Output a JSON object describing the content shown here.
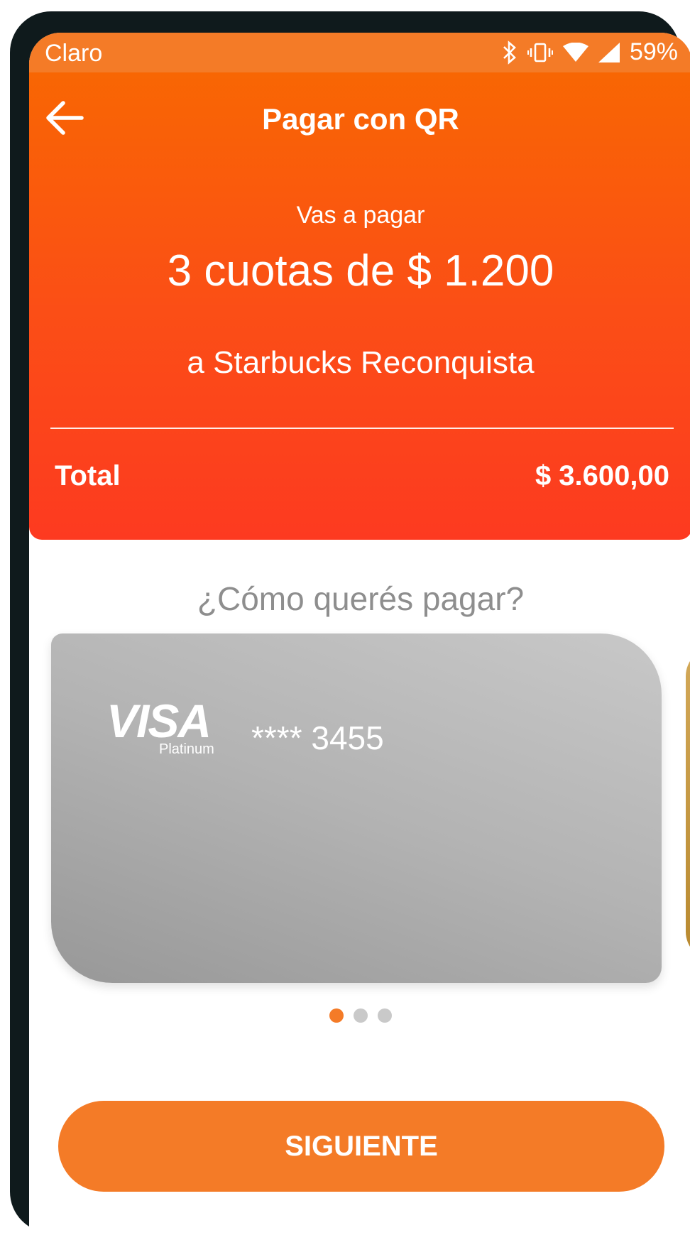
{
  "status_bar": {
    "carrier": "Claro",
    "battery": "59%",
    "icons": [
      "bluetooth-icon",
      "vibrate-icon",
      "wifi-icon",
      "signal-icon"
    ]
  },
  "header": {
    "back_icon": "arrow-left-icon",
    "title": "Pagar con QR",
    "lead": "Vas a pagar",
    "amount": "3 cuotas de $ 1.200",
    "merchant": "a Starbucks Reconquista",
    "total_label": "Total",
    "total_value": "$ 3.600,00"
  },
  "payment": {
    "question": "¿Cómo querés pagar?",
    "card": {
      "brand": "VISA",
      "tier": "Platinum",
      "number": "**** 3455"
    },
    "pages": {
      "count": 3,
      "active": 1
    }
  },
  "actions": {
    "next_label": "SIGUIENTE"
  },
  "colors": {
    "accent": "#f47b27",
    "header_top": "#f86a00",
    "header_bottom": "#fd3a20",
    "card_gray": "#b3b3b3",
    "inactive_dot": "#c9c9c9"
  }
}
